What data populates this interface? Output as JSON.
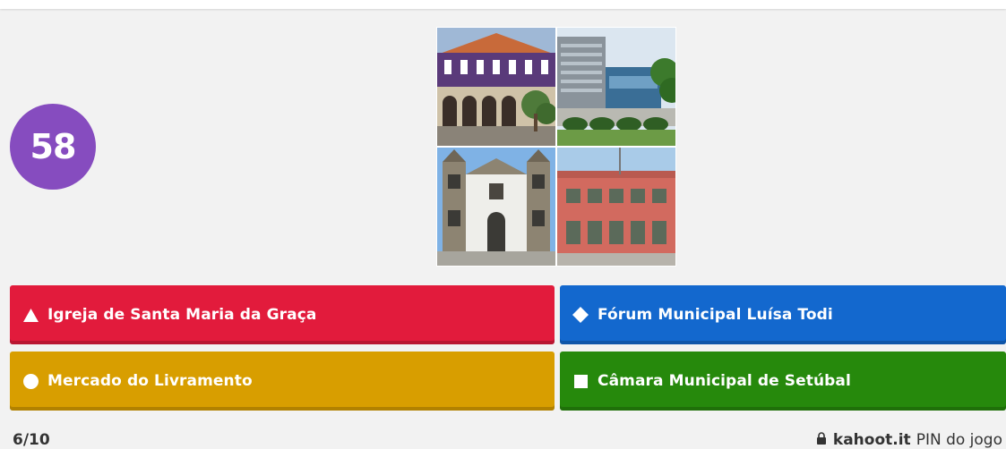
{
  "question": {
    "timer": "58",
    "progress": "6/10"
  },
  "answers": [
    {
      "shape": "triangle-icon",
      "label": "Igreja de Santa Maria da Graça",
      "color": "#e21b3c"
    },
    {
      "shape": "diamond-icon",
      "label": "Fórum Municipal Luísa Todi",
      "color": "#1368ce"
    },
    {
      "shape": "circle-icon",
      "label": "Mercado do Livramento",
      "color": "#d89e00"
    },
    {
      "shape": "square-icon",
      "label": "Câmara Municipal de Setúbal",
      "color": "#26890c"
    }
  ],
  "footer": {
    "brand": "kahoot.it",
    "pin_label": "PIN do jogo"
  },
  "colors": {
    "timer": "#864cbf",
    "background": "#f2f2f2"
  }
}
